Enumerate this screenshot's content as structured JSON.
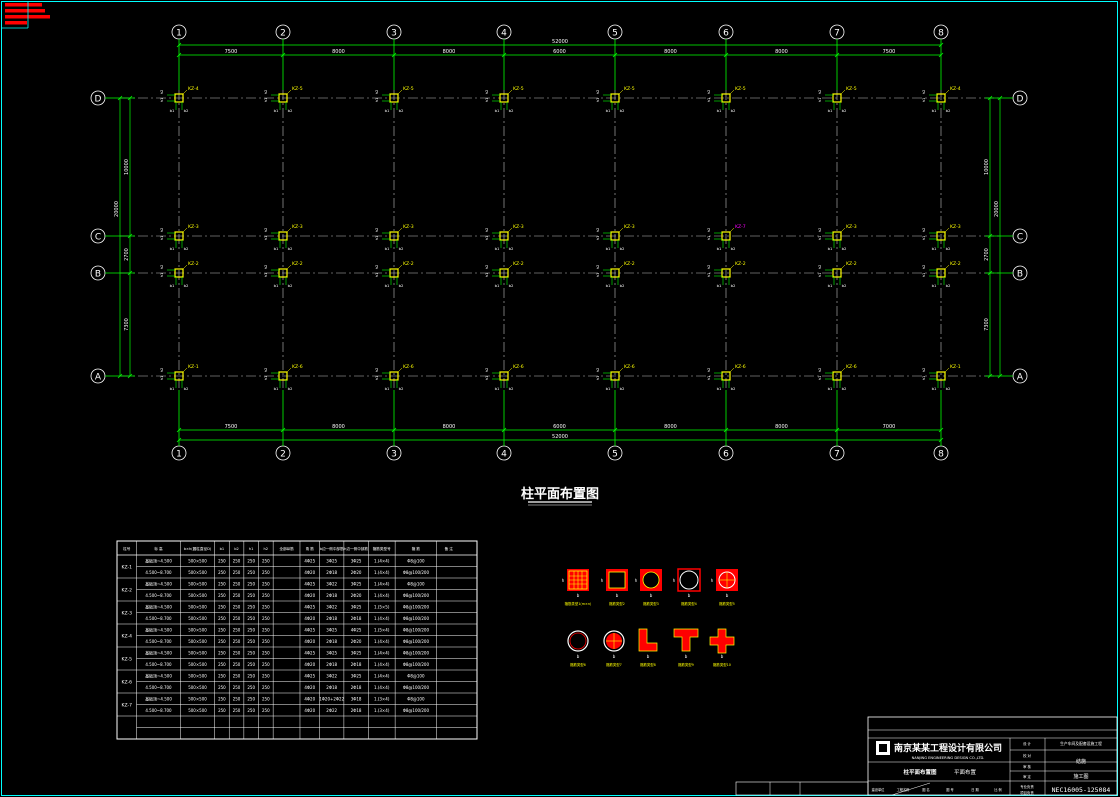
{
  "drawing": {
    "title": "柱平面布置图",
    "grid_x_labels": [
      "1",
      "2",
      "3",
      "4",
      "5",
      "6",
      "7",
      "8"
    ],
    "grid_y_labels": [
      "D",
      "C",
      "B",
      "A"
    ],
    "top_overall": "52000",
    "top_spans": [
      "7500",
      "8000",
      "8000",
      "6000",
      "8000",
      "8000",
      "7500"
    ],
    "bottom_overall": "52000",
    "bottom_spans": [
      "7500",
      "8000",
      "8000",
      "6000",
      "8000",
      "8000",
      "7000"
    ],
    "left_overall": "20000",
    "left_spans": [
      "10000",
      "2700",
      "7300"
    ],
    "right_overall": "20000",
    "right_spans": [
      "10000",
      "2700",
      "7300"
    ],
    "row_tags": {
      "D": [
        "KZ-4",
        "KZ-5",
        "KZ-5",
        "KZ-5",
        "KZ-5",
        "KZ-5",
        "KZ-5",
        "KZ-4"
      ],
      "C": [
        "KZ-3",
        "KZ-3",
        "KZ-3",
        "KZ-3",
        "KZ-3",
        "KZ-7",
        "KZ-3",
        "KZ-3"
      ],
      "B": [
        "KZ-2",
        "KZ-2",
        "KZ-2",
        "KZ-2",
        "KZ-2",
        "KZ-2",
        "KZ-2",
        "KZ-2"
      ],
      "A": [
        "KZ-1",
        "KZ-6",
        "KZ-6",
        "KZ-6",
        "KZ-6",
        "KZ-6",
        "KZ-6",
        "KZ-1"
      ]
    },
    "highlight_tag_index": {
      "row": "C",
      "col": 5
    }
  },
  "schedule": {
    "headers": [
      "柱号",
      "标 高",
      "b×h(圆柱直径D)",
      "b1",
      "b2",
      "h1",
      "h2",
      "全部纵筋",
      "角 筋",
      "b边一侧中部筋",
      "h边一侧中部筋",
      "箍筋类型号",
      "箍 筋",
      "备 注"
    ],
    "groups": [
      "KZ-1",
      "KZ-2",
      "KZ-3",
      "KZ-4",
      "KZ-5",
      "KZ-6",
      "KZ-7"
    ],
    "rows": [
      [
        "",
        "基础顶~4.500",
        "500×500",
        "250",
        "250",
        "250",
        "250",
        "",
        "4Φ25",
        "3Φ25",
        "3Φ25",
        "1.(4×4)",
        "Φ8@100",
        ""
      ],
      [
        "",
        "4.500~8.700",
        "500×500",
        "250",
        "250",
        "250",
        "250",
        "",
        "4Φ20",
        "2Φ18",
        "2Φ20",
        "1.(4×4)",
        "Φ8@100/200",
        ""
      ],
      [
        "",
        "基础顶~4.500",
        "500×500",
        "250",
        "250",
        "250",
        "250",
        "",
        "4Φ25",
        "3Φ22",
        "3Φ25",
        "1.(4×4)",
        "Φ8@100",
        ""
      ],
      [
        "",
        "4.500~8.700",
        "500×500",
        "250",
        "250",
        "250",
        "250",
        "",
        "4Φ20",
        "2Φ18",
        "2Φ20",
        "1.(4×4)",
        "Φ8@100/200",
        ""
      ],
      [
        "",
        "基础顶~4.500",
        "500×500",
        "250",
        "250",
        "250",
        "250",
        "",
        "4Φ25",
        "3Φ22",
        "3Φ25",
        "1.(5×5)",
        "Φ8@100/200",
        ""
      ],
      [
        "",
        "4.500~8.700",
        "500×500",
        "250",
        "250",
        "250",
        "250",
        "",
        "4Φ20",
        "2Φ18",
        "2Φ18",
        "1.(4×4)",
        "Φ8@100/200",
        ""
      ],
      [
        "",
        "基础顶~4.500",
        "500×500",
        "250",
        "250",
        "250",
        "250",
        "",
        "4Φ25",
        "3Φ25",
        "4Φ25",
        "1.(5×4)",
        "Φ8@100/200",
        ""
      ],
      [
        "",
        "4.500~8.700",
        "500×500",
        "250",
        "250",
        "250",
        "250",
        "",
        "4Φ20",
        "2Φ18",
        "2Φ20",
        "1.(4×4)",
        "Φ8@100/200",
        ""
      ],
      [
        "",
        "基础顶~4.500",
        "500×500",
        "250",
        "250",
        "250",
        "250",
        "",
        "4Φ25",
        "3Φ25",
        "3Φ25",
        "1.(4×4)",
        "Φ8@100/200",
        ""
      ],
      [
        "",
        "4.500~8.700",
        "500×500",
        "250",
        "250",
        "250",
        "250",
        "",
        "4Φ20",
        "2Φ18",
        "2Φ18",
        "1.(4×4)",
        "Φ8@100/200",
        ""
      ],
      [
        "",
        "基础顶~4.500",
        "500×500",
        "250",
        "250",
        "250",
        "250",
        "",
        "4Φ25",
        "3Φ22",
        "3Φ25",
        "1.(4×4)",
        "Φ8@100",
        ""
      ],
      [
        "",
        "4.500~8.700",
        "500×500",
        "250",
        "250",
        "250",
        "250",
        "",
        "4Φ20",
        "2Φ18",
        "2Φ18",
        "1.(4×4)",
        "Φ8@100/200",
        ""
      ],
      [
        "",
        "基础顶~4.500",
        "500×500",
        "250",
        "250",
        "250",
        "250",
        "",
        "4Φ20",
        "1Φ20+2Φ22",
        "3Φ18",
        "1.(3×4)",
        "Φ8@100",
        ""
      ],
      [
        "",
        "4.500~8.700",
        "500×500",
        "250",
        "250",
        "250",
        "250",
        "",
        "4Φ20",
        "2Φ22",
        "2Φ18",
        "1.(3×4)",
        "Φ8@100/200",
        ""
      ],
      [
        "",
        "",
        "",
        "",
        "",
        "",
        "",
        "",
        "",
        "",
        "",
        "",
        "",
        ""
      ],
      [
        "",
        "",
        "",
        "",
        "",
        "",
        "",
        "",
        "",
        "",
        "",
        "",
        "",
        ""
      ]
    ]
  },
  "legend": {
    "row1": [
      "箍筋类型1(m×n)",
      "箍筋类型2",
      "箍筋类型3",
      "箍筋类型4",
      "箍筋类型5"
    ],
    "row2": [
      "箍筋类型6",
      "箍筋类型7",
      "箍筋类型8",
      "箍筋类型9",
      "箍筋类型10"
    ],
    "side_marks": [
      "b",
      "h"
    ]
  },
  "title_block": {
    "company": "南京某某工程设计有限公司",
    "company_en": "NANJING ENGINEERING DESIGN CO.,LTD.",
    "project": "生产车间及配套设施工程",
    "sheet_name": "柱平面布置图",
    "sheet_sub": "平面布置",
    "discipline": "结施",
    "stage": "施工图",
    "drawing_no": "NEC16005-125084",
    "fields": [
      "设 计",
      "校 对",
      "审 核",
      "审 定",
      "专业负责",
      "项目负责",
      "建设单位",
      "工程名称",
      "图 名",
      "图 号",
      "日 期",
      "比 例"
    ]
  },
  "corner_bars": 4,
  "colors": {
    "background": "#000000",
    "grid_axis": "#00ff00",
    "dimension": "#00ff00",
    "center_line": "#bfbfbf",
    "column": "#ffff00",
    "tag": "#ffff00",
    "highlight_tag": "#ff00ff",
    "rebar": "#ff0000",
    "frame": "#00ffff",
    "text": "#ffffff",
    "stamp": "#ff0000"
  }
}
